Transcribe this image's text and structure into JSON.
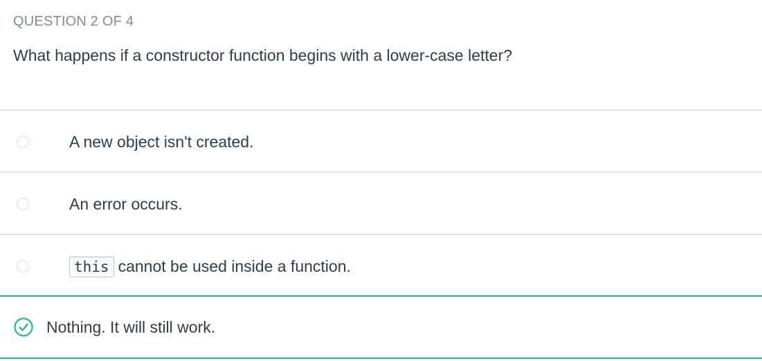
{
  "question": {
    "counter": "QUESTION 2 OF 4",
    "text": "What happens if a constructor function begins with a lower-case letter?"
  },
  "options": [
    {
      "label": "A new object isn't created.",
      "state": "unselected"
    },
    {
      "label": "An error occurs.",
      "state": "unselected"
    },
    {
      "code": "this",
      "label": "cannot be used inside a function.",
      "state": "unselected"
    },
    {
      "label": "Nothing. It will still work.",
      "state": "correct"
    }
  ],
  "colors": {
    "correct": "#1fb98a",
    "divider": "#dbe2e8",
    "muted_text": "#7d8c97",
    "text": "#2e3d49"
  },
  "icons": {
    "radio": "radio-circle-icon",
    "correct": "check-circle-icon"
  }
}
